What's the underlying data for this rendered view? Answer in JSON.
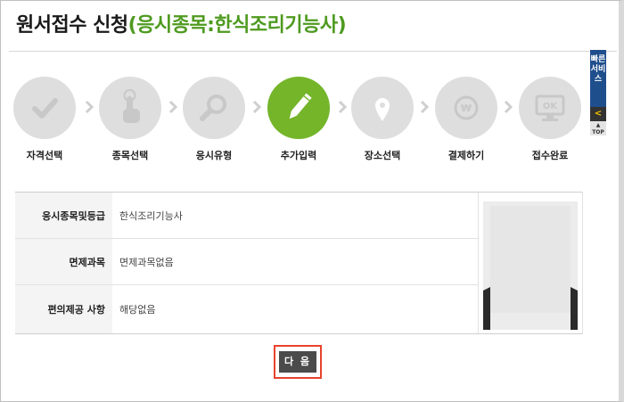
{
  "page": {
    "title_main": "원서접수 신청",
    "title_sub": "(응시종목:한식조리기능사)"
  },
  "steps": [
    {
      "label": "자격선택",
      "icon": "checkmark-icon",
      "active": false
    },
    {
      "label": "종목선택",
      "icon": "pointer-hand-icon",
      "active": false
    },
    {
      "label": "응시유형",
      "icon": "magnifier-icon",
      "active": false
    },
    {
      "label": "추가입력",
      "icon": "pencil-icon",
      "active": true
    },
    {
      "label": "장소선택",
      "icon": "location-pin-icon",
      "active": false
    },
    {
      "label": "결제하기",
      "icon": "won-coin-icon",
      "active": false
    },
    {
      "label": "접수완료",
      "icon": "ok-monitor-icon",
      "active": false
    }
  ],
  "quick_menu": {
    "label": "빠른서비스",
    "collapse": "<",
    "top": "TOP"
  },
  "info": {
    "rows": [
      {
        "label": "응시종목및등급",
        "value": "한식조리기능사"
      },
      {
        "label": "면제과목",
        "value": "면제과목없음"
      },
      {
        "label": "편의제공 사항",
        "value": "해당없음"
      }
    ]
  },
  "buttons": {
    "next": "다 음"
  },
  "colors": {
    "accent_green": "#74b52a",
    "title_green": "#4e9a1f",
    "step_gray": "#dedede",
    "highlight_red": "#e8432b",
    "button_dark": "#4b4b4b",
    "quick_blue": "#1f4e8c"
  }
}
